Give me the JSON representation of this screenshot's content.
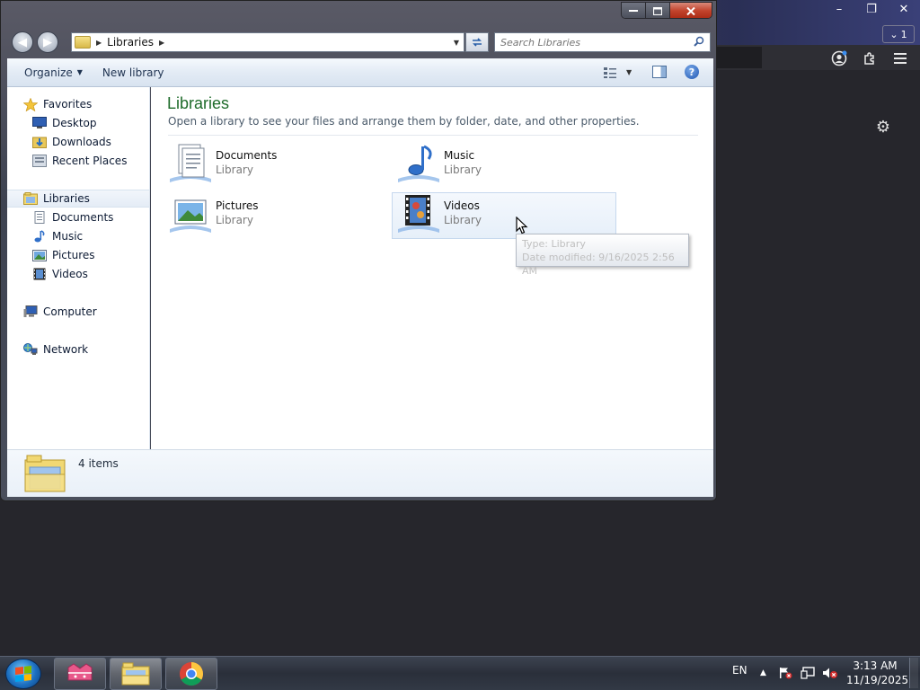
{
  "background_browser": {
    "tab_count": "1",
    "window_controls": [
      "–",
      "❐",
      "✕"
    ]
  },
  "explorer": {
    "address": {
      "segments": [
        "Libraries"
      ]
    },
    "search": {
      "placeholder": "Search Libraries"
    },
    "commands": {
      "organize": "Organize",
      "new_library": "New library"
    },
    "nav": {
      "favorites": {
        "label": "Favorites",
        "items": [
          "Desktop",
          "Downloads",
          "Recent Places"
        ]
      },
      "libraries": {
        "label": "Libraries",
        "items": [
          "Documents",
          "Music",
          "Pictures",
          "Videos"
        ]
      },
      "computer": "Computer",
      "network": "Network"
    },
    "content": {
      "title": "Libraries",
      "description": "Open a library to see your files and arrange them by folder, date, and other properties.",
      "libraries": [
        {
          "name": "Documents",
          "type": "Library",
          "icon": "documents-library-icon"
        },
        {
          "name": "Music",
          "type": "Library",
          "icon": "music-library-icon"
        },
        {
          "name": "Pictures",
          "type": "Library",
          "icon": "pictures-library-icon"
        },
        {
          "name": "Videos",
          "type": "Library",
          "icon": "videos-library-icon"
        }
      ]
    },
    "tooltip": {
      "type": "Type: Library",
      "modified": "Date modified: 9/16/2025 2:56 AM"
    },
    "details": {
      "count": "4 items"
    }
  },
  "taskbar": {
    "language": "EN",
    "time": "3:13 AM",
    "date": "11/19/2025"
  },
  "colors": {
    "title_green": "#1e6b2a",
    "close_red": "#c2432c",
    "taskbar": "#2a2f3a"
  }
}
